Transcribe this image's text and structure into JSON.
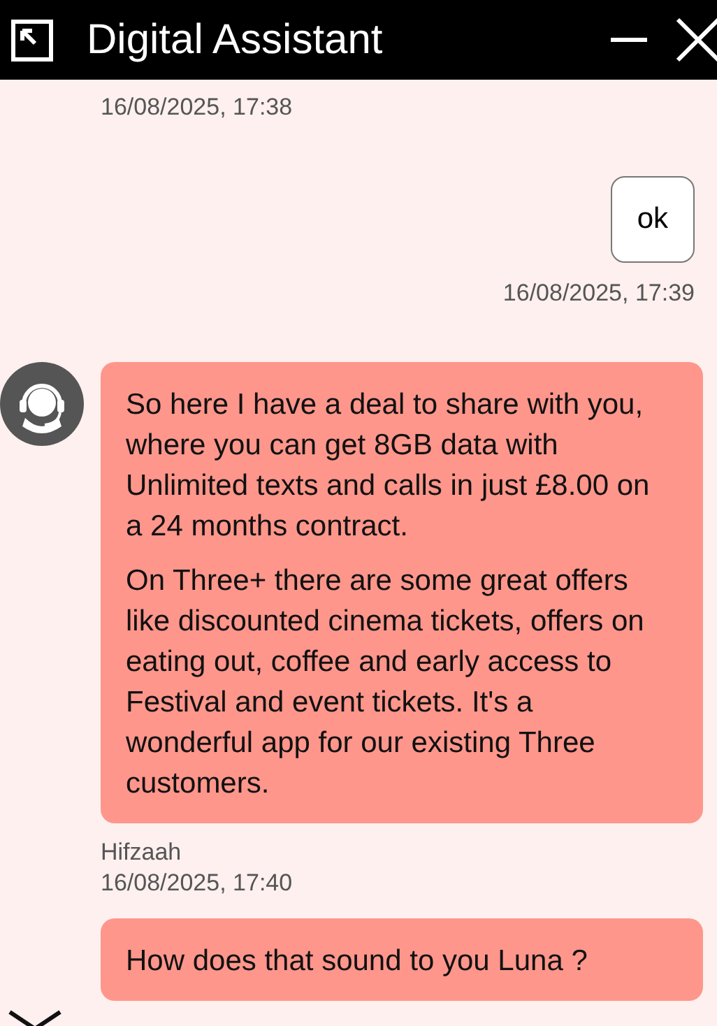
{
  "window": {
    "title": "Digital Assistant"
  },
  "messages": [
    {
      "kind": "meta",
      "time": "16/08/2025, 17:38"
    },
    {
      "kind": "user",
      "text": "ok",
      "time": "16/08/2025, 17:39"
    },
    {
      "kind": "agent",
      "avatar": true,
      "paragraphs": [
        "So here I have a deal to share with you, where you can get 8GB data with Unlimited texts and calls in just £8.00 on a 24 months contract.",
        "On Three+ there are some great offers like discounted cinema tickets, offers on eating out, coffee and early access to Festival and event tickets. It's a wonderful app for our existing Three customers."
      ]
    },
    {
      "kind": "meta",
      "name": "Hifzaah",
      "time": "16/08/2025, 17:40"
    },
    {
      "kind": "agent",
      "avatar": false,
      "paragraphs": [
        "How does that sound to you Luna ?"
      ]
    }
  ]
}
